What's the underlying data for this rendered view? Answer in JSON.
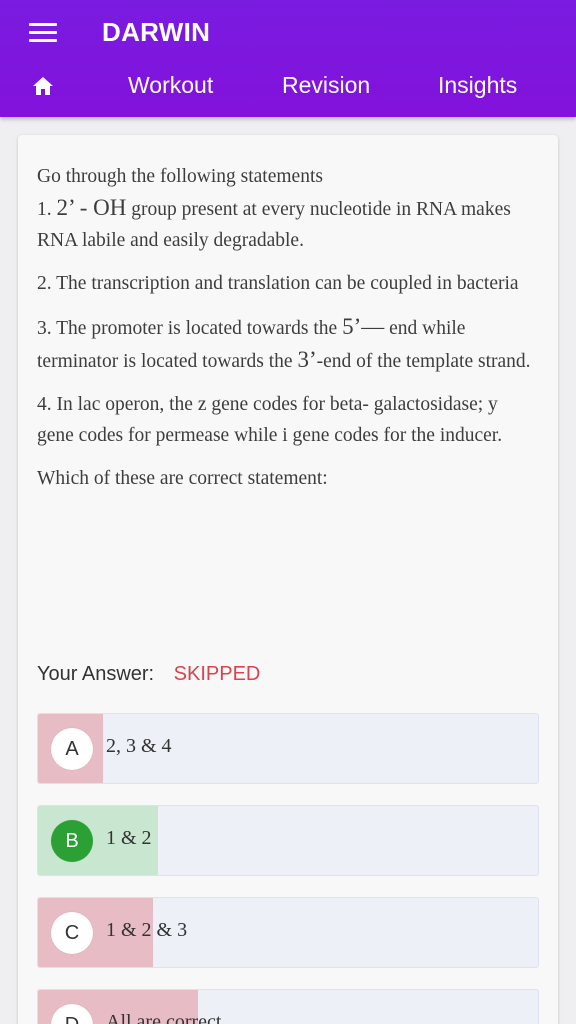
{
  "app": {
    "title": "DARWIN",
    "accent_color": "#7a1be0",
    "menu_icon": "hamburger-menu-icon",
    "home_icon": "home-icon"
  },
  "nav": {
    "tabs": [
      {
        "label": "Workout"
      },
      {
        "label": "Revision"
      },
      {
        "label": "Insights"
      }
    ]
  },
  "question": {
    "intro": "Go through the following statements",
    "s1_num": "1.",
    "s1_math": "2’ - OH",
    "s1_text": "group present at every nucleotide in RNA makes RNA labile and easily degradable.",
    "s2": "2. The transcription and translation can be coupled in bacteria",
    "s3_a": "3. The promoter is located towards the",
    "s3_math1": "5’—",
    "s3_b": "end while terminator is located towards the",
    "s3_math2": "3’",
    "s3_c": "-end of the template strand.",
    "s4": "4. In lac operon, the z gene codes for beta- galactosidase; y gene codes for permease while i gene codes for the inducer.",
    "prompt": "Which of these are correct statement:"
  },
  "answer": {
    "label": "Your Answer:",
    "value": "SKIPPED",
    "value_color": "#d9434e"
  },
  "options": [
    {
      "letter": "A",
      "text": "2, 3 & 4",
      "response_share": 0.13,
      "state": "incorrect"
    },
    {
      "letter": "B",
      "text": "1 & 2",
      "response_share": 0.24,
      "state": "correct"
    },
    {
      "letter": "C",
      "text": "1 & 2 & 3",
      "response_share": 0.23,
      "state": "incorrect"
    },
    {
      "letter": "D",
      "text": "All are correct",
      "response_share": 0.32,
      "state": "incorrect"
    }
  ],
  "colors": {
    "correct": "#2ba135",
    "incorrect_fill": "#e7bcc5",
    "correct_fill": "#c9e6d1"
  }
}
